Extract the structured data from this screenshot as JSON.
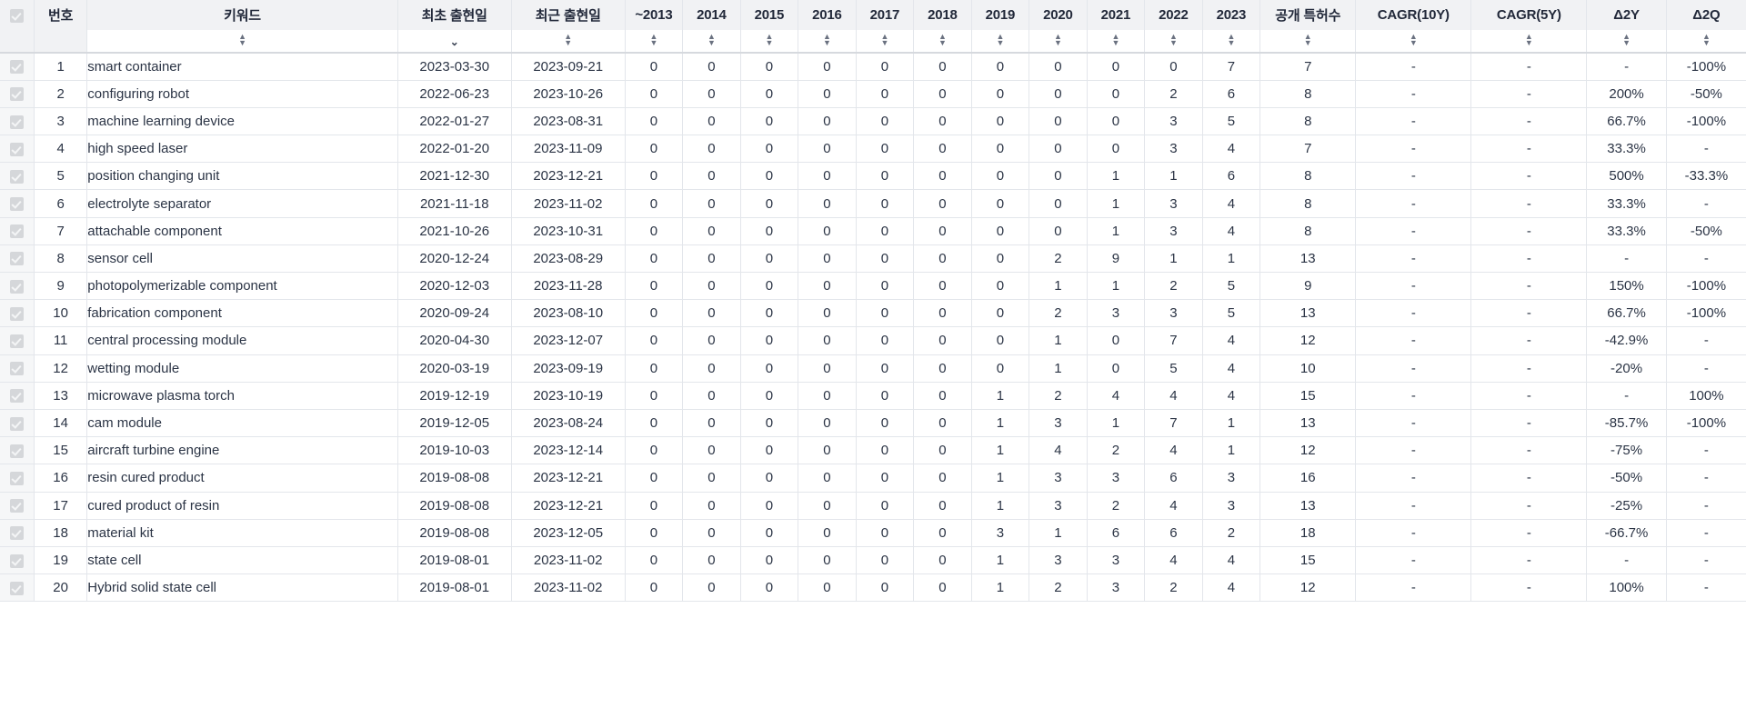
{
  "table": {
    "header": {
      "select_all_checkbox": "select-all",
      "columns": [
        {
          "key": "no",
          "label": "번호",
          "sort": "both"
        },
        {
          "key": "keyword",
          "label": "키워드",
          "sort": "both"
        },
        {
          "key": "first",
          "label": "최초 출현일",
          "sort": "desc"
        },
        {
          "key": "last",
          "label": "최근 출현일",
          "sort": "both"
        },
        {
          "key": "y2013",
          "label": "~2013",
          "sort": "both"
        },
        {
          "key": "y2014",
          "label": "2014",
          "sort": "both"
        },
        {
          "key": "y2015",
          "label": "2015",
          "sort": "both"
        },
        {
          "key": "y2016",
          "label": "2016",
          "sort": "both"
        },
        {
          "key": "y2017",
          "label": "2017",
          "sort": "both"
        },
        {
          "key": "y2018",
          "label": "2018",
          "sort": "both"
        },
        {
          "key": "y2019",
          "label": "2019",
          "sort": "both"
        },
        {
          "key": "y2020",
          "label": "2020",
          "sort": "both"
        },
        {
          "key": "y2021",
          "label": "2021",
          "sort": "both"
        },
        {
          "key": "y2022",
          "label": "2022",
          "sort": "both"
        },
        {
          "key": "y2023",
          "label": "2023",
          "sort": "both"
        },
        {
          "key": "total",
          "label": "공개 특허수",
          "sort": "both"
        },
        {
          "key": "cagr10",
          "label": "CAGR(10Y)",
          "sort": "both"
        },
        {
          "key": "cagr5",
          "label": "CAGR(5Y)",
          "sort": "both"
        },
        {
          "key": "d2y",
          "label": "Δ2Y",
          "sort": "both"
        },
        {
          "key": "d2q",
          "label": "Δ2Q",
          "sort": "both"
        }
      ],
      "sort_icon_up": "▲",
      "sort_icon_down": "▼",
      "active_sort_column": "최초 출현일",
      "active_sort_direction": "▼"
    },
    "rows": [
      {
        "no": "1",
        "keyword": "smart container",
        "first": "2023-03-30",
        "last": "2023-09-21",
        "years": [
          "0",
          "0",
          "0",
          "0",
          "0",
          "0",
          "0",
          "0",
          "0",
          "0",
          "7"
        ],
        "total": "7",
        "cagr10": "-",
        "cagr5": "-",
        "d2y": "-",
        "d2q": "-100%"
      },
      {
        "no": "2",
        "keyword": "configuring robot",
        "first": "2022-06-23",
        "last": "2023-10-26",
        "years": [
          "0",
          "0",
          "0",
          "0",
          "0",
          "0",
          "0",
          "0",
          "0",
          "2",
          "6"
        ],
        "total": "8",
        "cagr10": "-",
        "cagr5": "-",
        "d2y": "200%",
        "d2q": "-50%"
      },
      {
        "no": "3",
        "keyword": "machine learning device",
        "first": "2022-01-27",
        "last": "2023-08-31",
        "years": [
          "0",
          "0",
          "0",
          "0",
          "0",
          "0",
          "0",
          "0",
          "0",
          "3",
          "5"
        ],
        "total": "8",
        "cagr10": "-",
        "cagr5": "-",
        "d2y": "66.7%",
        "d2q": "-100%"
      },
      {
        "no": "4",
        "keyword": "high speed laser",
        "first": "2022-01-20",
        "last": "2023-11-09",
        "years": [
          "0",
          "0",
          "0",
          "0",
          "0",
          "0",
          "0",
          "0",
          "0",
          "3",
          "4"
        ],
        "total": "7",
        "cagr10": "-",
        "cagr5": "-",
        "d2y": "33.3%",
        "d2q": "-"
      },
      {
        "no": "5",
        "keyword": "position changing unit",
        "first": "2021-12-30",
        "last": "2023-12-21",
        "years": [
          "0",
          "0",
          "0",
          "0",
          "0",
          "0",
          "0",
          "0",
          "1",
          "1",
          "6"
        ],
        "total": "8",
        "cagr10": "-",
        "cagr5": "-",
        "d2y": "500%",
        "d2q": "-33.3%"
      },
      {
        "no": "6",
        "keyword": "electrolyte separator",
        "first": "2021-11-18",
        "last": "2023-11-02",
        "years": [
          "0",
          "0",
          "0",
          "0",
          "0",
          "0",
          "0",
          "0",
          "1",
          "3",
          "4"
        ],
        "total": "8",
        "cagr10": "-",
        "cagr5": "-",
        "d2y": "33.3%",
        "d2q": "-"
      },
      {
        "no": "7",
        "keyword": "attachable component",
        "first": "2021-10-26",
        "last": "2023-10-31",
        "years": [
          "0",
          "0",
          "0",
          "0",
          "0",
          "0",
          "0",
          "0",
          "1",
          "3",
          "4"
        ],
        "total": "8",
        "cagr10": "-",
        "cagr5": "-",
        "d2y": "33.3%",
        "d2q": "-50%"
      },
      {
        "no": "8",
        "keyword": "sensor cell",
        "first": "2020-12-24",
        "last": "2023-08-29",
        "years": [
          "0",
          "0",
          "0",
          "0",
          "0",
          "0",
          "0",
          "2",
          "9",
          "1",
          "1"
        ],
        "total": "13",
        "cagr10": "-",
        "cagr5": "-",
        "d2y": "-",
        "d2q": "-"
      },
      {
        "no": "9",
        "keyword": "photopolymerizable component",
        "first": "2020-12-03",
        "last": "2023-11-28",
        "years": [
          "0",
          "0",
          "0",
          "0",
          "0",
          "0",
          "0",
          "1",
          "1",
          "2",
          "5"
        ],
        "total": "9",
        "cagr10": "-",
        "cagr5": "-",
        "d2y": "150%",
        "d2q": "-100%"
      },
      {
        "no": "10",
        "keyword": "fabrication component",
        "first": "2020-09-24",
        "last": "2023-08-10",
        "years": [
          "0",
          "0",
          "0",
          "0",
          "0",
          "0",
          "0",
          "2",
          "3",
          "3",
          "5"
        ],
        "total": "13",
        "cagr10": "-",
        "cagr5": "-",
        "d2y": "66.7%",
        "d2q": "-100%"
      },
      {
        "no": "11",
        "keyword": "central processing module",
        "first": "2020-04-30",
        "last": "2023-12-07",
        "years": [
          "0",
          "0",
          "0",
          "0",
          "0",
          "0",
          "0",
          "1",
          "0",
          "7",
          "4"
        ],
        "total": "12",
        "cagr10": "-",
        "cagr5": "-",
        "d2y": "-42.9%",
        "d2q": "-"
      },
      {
        "no": "12",
        "keyword": "wetting module",
        "first": "2020-03-19",
        "last": "2023-09-19",
        "years": [
          "0",
          "0",
          "0",
          "0",
          "0",
          "0",
          "0",
          "1",
          "0",
          "5",
          "4"
        ],
        "total": "10",
        "cagr10": "-",
        "cagr5": "-",
        "d2y": "-20%",
        "d2q": "-"
      },
      {
        "no": "13",
        "keyword": "microwave plasma torch",
        "first": "2019-12-19",
        "last": "2023-10-19",
        "years": [
          "0",
          "0",
          "0",
          "0",
          "0",
          "0",
          "1",
          "2",
          "4",
          "4",
          "4"
        ],
        "total": "15",
        "cagr10": "-",
        "cagr5": "-",
        "d2y": "-",
        "d2q": "100%"
      },
      {
        "no": "14",
        "keyword": "cam module",
        "first": "2019-12-05",
        "last": "2023-08-24",
        "years": [
          "0",
          "0",
          "0",
          "0",
          "0",
          "0",
          "1",
          "3",
          "1",
          "7",
          "1"
        ],
        "total": "13",
        "cagr10": "-",
        "cagr5": "-",
        "d2y": "-85.7%",
        "d2q": "-100%"
      },
      {
        "no": "15",
        "keyword": "aircraft turbine engine",
        "first": "2019-10-03",
        "last": "2023-12-14",
        "years": [
          "0",
          "0",
          "0",
          "0",
          "0",
          "0",
          "1",
          "4",
          "2",
          "4",
          "1"
        ],
        "total": "12",
        "cagr10": "-",
        "cagr5": "-",
        "d2y": "-75%",
        "d2q": "-"
      },
      {
        "no": "16",
        "keyword": "resin cured product",
        "first": "2019-08-08",
        "last": "2023-12-21",
        "years": [
          "0",
          "0",
          "0",
          "0",
          "0",
          "0",
          "1",
          "3",
          "3",
          "6",
          "3"
        ],
        "total": "16",
        "cagr10": "-",
        "cagr5": "-",
        "d2y": "-50%",
        "d2q": "-"
      },
      {
        "no": "17",
        "keyword": "cured product of resin",
        "first": "2019-08-08",
        "last": "2023-12-21",
        "years": [
          "0",
          "0",
          "0",
          "0",
          "0",
          "0",
          "1",
          "3",
          "2",
          "4",
          "3"
        ],
        "total": "13",
        "cagr10": "-",
        "cagr5": "-",
        "d2y": "-25%",
        "d2q": "-"
      },
      {
        "no": "18",
        "keyword": "material kit",
        "first": "2019-08-08",
        "last": "2023-12-05",
        "years": [
          "0",
          "0",
          "0",
          "0",
          "0",
          "0",
          "3",
          "1",
          "6",
          "6",
          "2"
        ],
        "total": "18",
        "cagr10": "-",
        "cagr5": "-",
        "d2y": "-66.7%",
        "d2q": "-"
      },
      {
        "no": "19",
        "keyword": "state cell",
        "first": "2019-08-01",
        "last": "2023-11-02",
        "years": [
          "0",
          "0",
          "0",
          "0",
          "0",
          "0",
          "1",
          "3",
          "3",
          "4",
          "4"
        ],
        "total": "15",
        "cagr10": "-",
        "cagr5": "-",
        "d2y": "-",
        "d2q": "-"
      },
      {
        "no": "20",
        "keyword": "Hybrid solid state cell",
        "first": "2019-08-01",
        "last": "2023-11-02",
        "years": [
          "0",
          "0",
          "0",
          "0",
          "0",
          "0",
          "1",
          "2",
          "3",
          "2",
          "4"
        ],
        "total": "12",
        "cagr10": "-",
        "cagr5": "-",
        "d2y": "100%",
        "d2q": "-"
      }
    ]
  },
  "chart_data": {
    "type": "table",
    "title": "",
    "categories": [
      "~2013",
      "2014",
      "2015",
      "2016",
      "2017",
      "2018",
      "2019",
      "2020",
      "2021",
      "2022",
      "2023"
    ],
    "series": [
      {
        "name": "smart container",
        "values": [
          0,
          0,
          0,
          0,
          0,
          0,
          0,
          0,
          0,
          0,
          7
        ],
        "total": 7
      },
      {
        "name": "configuring robot",
        "values": [
          0,
          0,
          0,
          0,
          0,
          0,
          0,
          0,
          0,
          2,
          6
        ],
        "total": 8
      },
      {
        "name": "machine learning device",
        "values": [
          0,
          0,
          0,
          0,
          0,
          0,
          0,
          0,
          0,
          3,
          5
        ],
        "total": 8
      },
      {
        "name": "high speed laser",
        "values": [
          0,
          0,
          0,
          0,
          0,
          0,
          0,
          0,
          0,
          3,
          4
        ],
        "total": 7
      },
      {
        "name": "position changing unit",
        "values": [
          0,
          0,
          0,
          0,
          0,
          0,
          0,
          0,
          1,
          1,
          6
        ],
        "total": 8
      },
      {
        "name": "electrolyte separator",
        "values": [
          0,
          0,
          0,
          0,
          0,
          0,
          0,
          0,
          1,
          3,
          4
        ],
        "total": 8
      },
      {
        "name": "attachable component",
        "values": [
          0,
          0,
          0,
          0,
          0,
          0,
          0,
          0,
          1,
          3,
          4
        ],
        "total": 8
      },
      {
        "name": "sensor cell",
        "values": [
          0,
          0,
          0,
          0,
          0,
          0,
          0,
          2,
          9,
          1,
          1
        ],
        "total": 13
      },
      {
        "name": "photopolymerizable component",
        "values": [
          0,
          0,
          0,
          0,
          0,
          0,
          0,
          1,
          1,
          2,
          5
        ],
        "total": 9
      },
      {
        "name": "fabrication component",
        "values": [
          0,
          0,
          0,
          0,
          0,
          0,
          0,
          2,
          3,
          3,
          5
        ],
        "total": 13
      },
      {
        "name": "central processing module",
        "values": [
          0,
          0,
          0,
          0,
          0,
          0,
          0,
          1,
          0,
          7,
          4
        ],
        "total": 12
      },
      {
        "name": "wetting module",
        "values": [
          0,
          0,
          0,
          0,
          0,
          0,
          0,
          1,
          0,
          5,
          4
        ],
        "total": 10
      },
      {
        "name": "microwave plasma torch",
        "values": [
          0,
          0,
          0,
          0,
          0,
          0,
          1,
          2,
          4,
          4,
          4
        ],
        "total": 15
      },
      {
        "name": "cam module",
        "values": [
          0,
          0,
          0,
          0,
          0,
          0,
          1,
          3,
          1,
          7,
          1
        ],
        "total": 13
      },
      {
        "name": "aircraft turbine engine",
        "values": [
          0,
          0,
          0,
          0,
          0,
          0,
          1,
          4,
          2,
          4,
          1
        ],
        "total": 12
      },
      {
        "name": "resin cured product",
        "values": [
          0,
          0,
          0,
          0,
          0,
          0,
          1,
          3,
          3,
          6,
          3
        ],
        "total": 16
      },
      {
        "name": "cured product of resin",
        "values": [
          0,
          0,
          0,
          0,
          0,
          0,
          1,
          3,
          2,
          4,
          3
        ],
        "total": 13
      },
      {
        "name": "material kit",
        "values": [
          0,
          0,
          0,
          0,
          0,
          0,
          3,
          1,
          6,
          6,
          2
        ],
        "total": 18
      },
      {
        "name": "state cell",
        "values": [
          0,
          0,
          0,
          0,
          0,
          0,
          1,
          3,
          3,
          4,
          4
        ],
        "total": 15
      },
      {
        "name": "Hybrid solid state cell",
        "values": [
          0,
          0,
          0,
          0,
          0,
          0,
          1,
          2,
          3,
          2,
          4
        ],
        "total": 12
      }
    ],
    "xlabel": "",
    "ylabel": "공개 특허수",
    "grid": true,
    "legend": "none"
  }
}
